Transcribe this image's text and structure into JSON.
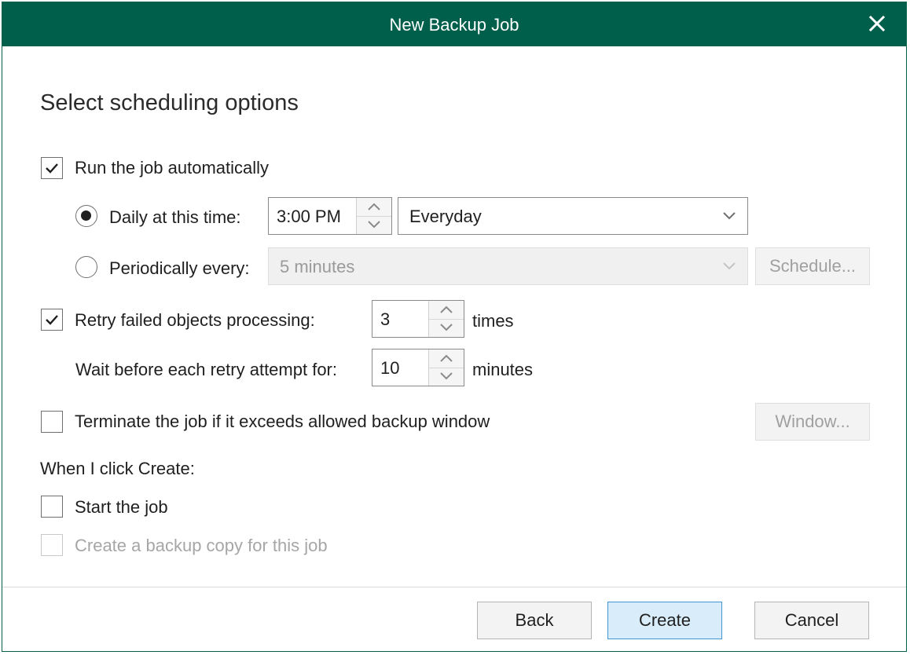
{
  "window": {
    "title": "New Backup Job"
  },
  "heading": "Select scheduling options",
  "run_auto": {
    "label": "Run the job automatically",
    "checked": true
  },
  "daily": {
    "label": "Daily at this time:",
    "time": "3:00 PM",
    "frequency": "Everyday",
    "selected": true
  },
  "periodic": {
    "label": "Periodically every:",
    "interval": "5 minutes",
    "schedule_button": "Schedule...",
    "selected": false
  },
  "retry": {
    "label": "Retry failed objects processing:",
    "count": "3",
    "unit": "times",
    "checked": true
  },
  "wait": {
    "label": "Wait before each retry attempt for:",
    "value": "10",
    "unit": "minutes"
  },
  "terminate": {
    "label": "Terminate the job if it exceeds allowed backup window",
    "window_button": "Window...",
    "checked": false
  },
  "when_click": {
    "label": "When I click Create:"
  },
  "start_job": {
    "label": "Start the job",
    "checked": false
  },
  "backup_copy": {
    "label": "Create a backup copy for this job",
    "checked": false,
    "disabled": true
  },
  "footer": {
    "back": "Back",
    "create": "Create",
    "cancel": "Cancel"
  },
  "colors": {
    "titlebar": "#005f4b",
    "primary_button_bg": "#d9ecf9",
    "primary_button_border": "#3f96d4"
  }
}
